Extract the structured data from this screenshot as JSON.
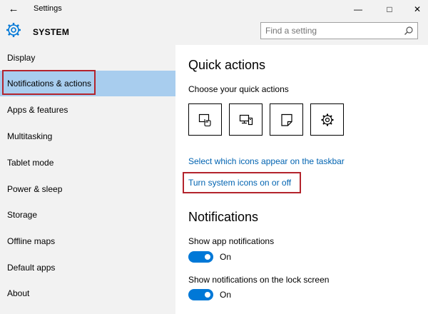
{
  "window": {
    "title": "Settings",
    "back_icon": "←",
    "minimize_icon": "—",
    "maximize_icon": "□",
    "close_icon": "✕"
  },
  "header": {
    "section_title": "SYSTEM",
    "search_placeholder": "Find a setting"
  },
  "sidebar": {
    "items": [
      {
        "label": "Display"
      },
      {
        "label": "Notifications & actions"
      },
      {
        "label": "Apps & features"
      },
      {
        "label": "Multitasking"
      },
      {
        "label": "Tablet mode"
      },
      {
        "label": "Power & sleep"
      },
      {
        "label": "Storage"
      },
      {
        "label": "Offline maps"
      },
      {
        "label": "Default apps"
      },
      {
        "label": "About"
      }
    ],
    "selected_index": 1
  },
  "main": {
    "quick_actions_heading": "Quick actions",
    "quick_actions_subheading": "Choose your quick actions",
    "quick_action_tiles": [
      {
        "icon": "tablet-mode-icon"
      },
      {
        "icon": "connect-icon"
      },
      {
        "icon": "note-icon"
      },
      {
        "icon": "settings-icon"
      }
    ],
    "link_taskbar_icons": "Select which icons appear on the taskbar",
    "link_system_icons": "Turn system icons on or off",
    "notifications_heading": "Notifications",
    "app_notifications_label": "Show app notifications",
    "app_notifications_state": "On",
    "lock_screen_label": "Show notifications on the lock screen",
    "lock_screen_state": "On"
  },
  "colors": {
    "accent": "#0078d7",
    "link": "#0063b1",
    "selected_bg": "#a8cdee",
    "highlight_box": "#b3232c",
    "chrome_bg": "#f2f2f2"
  }
}
